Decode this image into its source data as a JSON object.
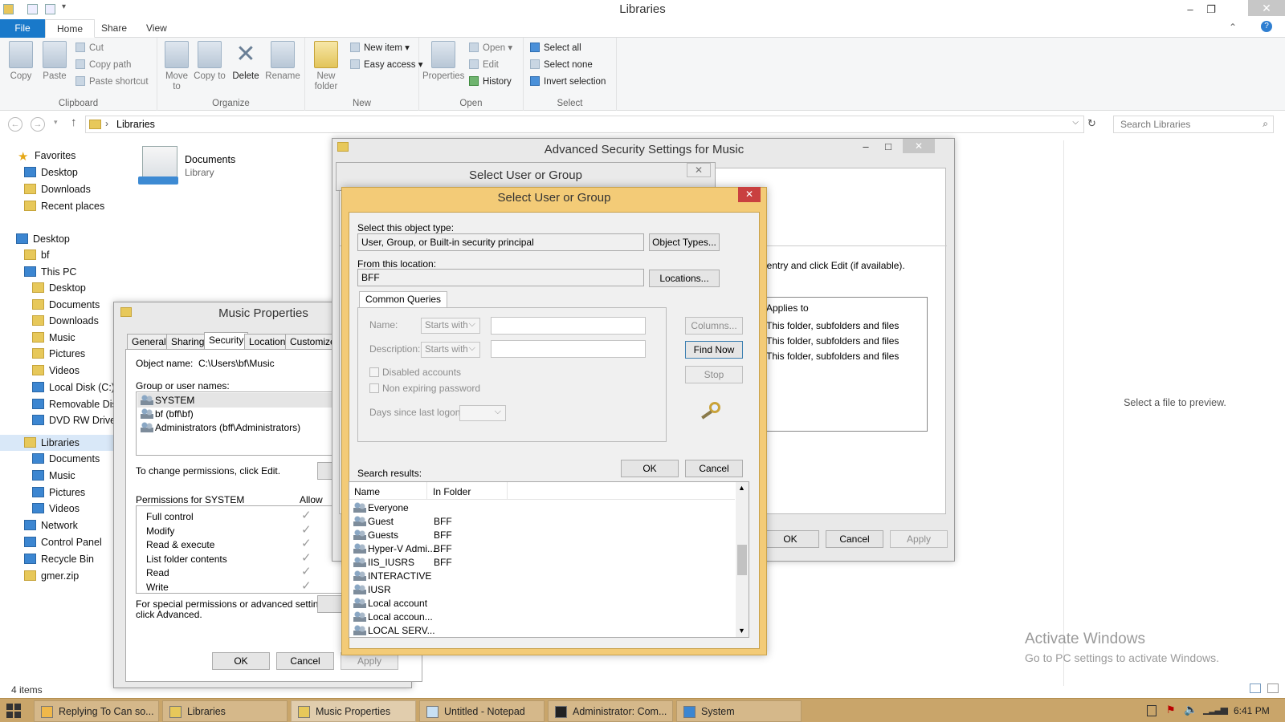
{
  "window": {
    "title": "Libraries"
  },
  "ribbon_tabs": [
    "File",
    "Home",
    "Share",
    "View"
  ],
  "ribbon": {
    "clipboard": {
      "label": "Clipboard",
      "copy": "Copy",
      "paste": "Paste",
      "cut": "Cut",
      "copy_path": "Copy path",
      "paste_shortcut": "Paste shortcut"
    },
    "organize": {
      "label": "Organize",
      "move_to": "Move to",
      "copy_to": "Copy to",
      "delete": "Delete",
      "rename": "Rename"
    },
    "new": {
      "label": "New",
      "new_folder": "New folder",
      "new_item": "New item",
      "easy_access": "Easy access"
    },
    "open": {
      "label": "Open",
      "properties": "Properties",
      "open": "Open",
      "edit": "Edit",
      "history": "History"
    },
    "select": {
      "label": "Select",
      "select_all": "Select all",
      "select_none": "Select none",
      "invert": "Invert selection"
    }
  },
  "address": {
    "path": "Libraries",
    "search_placeholder": "Search Libraries"
  },
  "nav": {
    "favorites": "Favorites",
    "desktop": "Desktop",
    "downloads": "Downloads",
    "recent": "Recent places",
    "desktop_root": "Desktop",
    "bf": "bf",
    "this_pc": "This PC",
    "pc_desktop": "Desktop",
    "pc_documents": "Documents",
    "pc_downloads": "Downloads",
    "pc_music": "Music",
    "pc_pictures": "Pictures",
    "pc_videos": "Videos",
    "local_disk": "Local Disk (C:)",
    "removable": "Removable Disl",
    "dvd": "DVD RW Drive (",
    "libraries": "Libraries",
    "lib_documents": "Documents",
    "lib_music": "Music",
    "lib_pictures": "Pictures",
    "lib_videos": "Videos",
    "network": "Network",
    "control_panel": "Control Panel",
    "recycle_bin": "Recycle Bin",
    "gmer": "gmer.zip"
  },
  "content": {
    "doc_name": "Documents",
    "doc_type": "Library"
  },
  "preview": {
    "text": "Select a file to preview."
  },
  "watermark": {
    "line1": "Activate Windows",
    "line2": "Go to PC settings to activate Windows."
  },
  "status": {
    "items": "4 items"
  },
  "music_props": {
    "title": "Music Properties",
    "tabs": [
      "General",
      "Sharing",
      "Security",
      "Location",
      "Customize"
    ],
    "object_label": "Object name:",
    "object_value": "C:\\Users\\bf\\Music",
    "group_label": "Group or user names:",
    "users": [
      "SYSTEM",
      "bf (bff\\bf)",
      "Administrators (bff\\Administrators)"
    ],
    "change_text": "To change permissions, click Edit.",
    "perm_label": "Permissions for SYSTEM",
    "allow": "Allow",
    "perms": [
      "Full control",
      "Modify",
      "Read & execute",
      "List folder contents",
      "Read",
      "Write"
    ],
    "special_text": "For special permissions or advanced settings,",
    "special_text2": "click Advanced.",
    "ok": "OK",
    "cancel": "Cancel",
    "apply": "Apply"
  },
  "adv_security": {
    "title": "Advanced Security Settings for Music",
    "hint": "he entry and click Edit (if available).",
    "applies_header": "Applies to",
    "applies": [
      "This folder, subfolders and files",
      "This folder, subfolders and files",
      "This folder, subfolders and files"
    ],
    "ok": "OK",
    "cancel": "Cancel",
    "apply": "Apply"
  },
  "select_back": {
    "title": "Select User or Group"
  },
  "select_user": {
    "title": "Select User or Group",
    "object_type_label": "Select this object type:",
    "object_type_value": "User, Group, or Built-in security principal",
    "object_types_btn": "Object Types...",
    "location_label": "From this location:",
    "location_value": "BFF",
    "locations_btn": "Locations...",
    "queries_tab": "Common Queries",
    "name_label": "Name:",
    "description_label": "Description:",
    "starts_with": "Starts with",
    "disabled_accounts": "Disabled accounts",
    "non_expiring": "Non expiring password",
    "days_label": "Days since last logon:",
    "columns_btn": "Columns...",
    "find_now_btn": "Find Now",
    "stop_btn": "Stop",
    "ok": "OK",
    "cancel": "Cancel",
    "results_label": "Search results:",
    "col_name": "Name",
    "col_folder": "In Folder",
    "results": [
      {
        "name": "Everyone",
        "folder": ""
      },
      {
        "name": "Guest",
        "folder": "BFF"
      },
      {
        "name": "Guests",
        "folder": "BFF"
      },
      {
        "name": "Hyper-V Admi...",
        "folder": "BFF"
      },
      {
        "name": "IIS_IUSRS",
        "folder": "BFF"
      },
      {
        "name": "INTERACTIVE",
        "folder": ""
      },
      {
        "name": "IUSR",
        "folder": ""
      },
      {
        "name": "Local account",
        "folder": ""
      },
      {
        "name": "Local accoun...",
        "folder": ""
      },
      {
        "name": "LOCAL SERV...",
        "folder": ""
      }
    ]
  },
  "taskbar": {
    "items": [
      "Replying To Can so...",
      "Libraries",
      "Music Properties",
      "Untitled - Notepad",
      "Administrator: Com...",
      "System"
    ],
    "time": "6:41 PM"
  }
}
